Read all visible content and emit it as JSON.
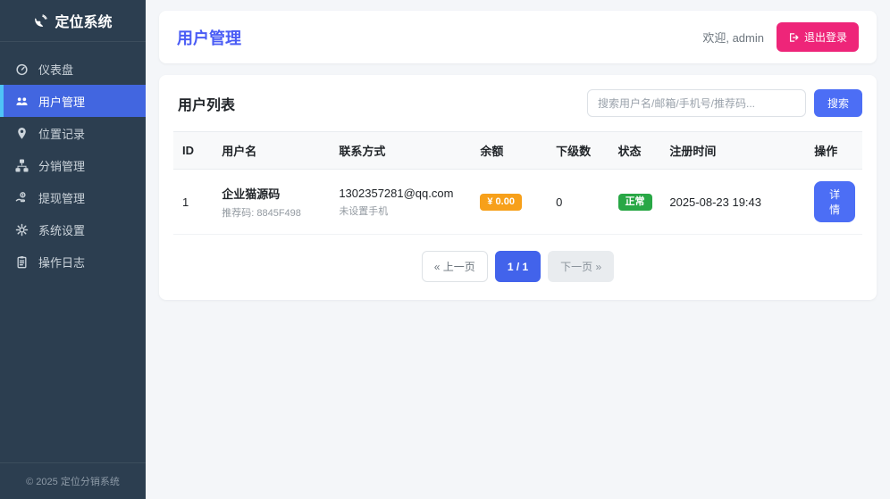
{
  "app": {
    "name": "定位系统",
    "copyright": "© 2025 定位分销系统"
  },
  "sidebar": {
    "items": [
      {
        "label": "仪表盘",
        "icon": "gauge-icon",
        "active": false
      },
      {
        "label": "用户管理",
        "icon": "users-icon",
        "active": true
      },
      {
        "label": "位置记录",
        "icon": "map-marker-icon",
        "active": false
      },
      {
        "label": "分销管理",
        "icon": "sitemap-icon",
        "active": false
      },
      {
        "label": "提现管理",
        "icon": "withdraw-icon",
        "active": false
      },
      {
        "label": "系统设置",
        "icon": "gear-icon",
        "active": false
      },
      {
        "label": "操作日志",
        "icon": "clipboard-icon",
        "active": false
      }
    ]
  },
  "header": {
    "title": "用户管理",
    "welcome": "欢迎, admin",
    "logout_label": "退出登录"
  },
  "userlist": {
    "title": "用户列表",
    "search_placeholder": "搜索用户名/邮箱/手机号/推荐码...",
    "search_button": "搜索",
    "columns": [
      "ID",
      "用户名",
      "联系方式",
      "余额",
      "下级数",
      "状态",
      "注册时间",
      "操作"
    ],
    "row": {
      "id": "1",
      "username": "企业猫源码",
      "ref_code": "推荐码: 8845F498",
      "email": "1302357281@qq.com",
      "phone": "未设置手机",
      "balance": "¥ 0.00",
      "subordinate_count": "0",
      "status": "正常",
      "register_time": "2025-08-23 19:43",
      "action": "详情"
    },
    "pagination": {
      "prev": "« 上一页",
      "current": "1 / 1",
      "next": "下一页 »"
    }
  },
  "colors": {
    "sidebar_bg": "#2c3e50",
    "active_item_bg": "#4266e0",
    "active_item_border": "#4fc3f7",
    "accent_blue": "#4c6ef5",
    "title_blue": "#4a5cf5",
    "logout_pink": "#ee2579",
    "balance_orange": "#f7a01a",
    "status_green": "#28a745",
    "page_bg": "#f4f6f9"
  }
}
